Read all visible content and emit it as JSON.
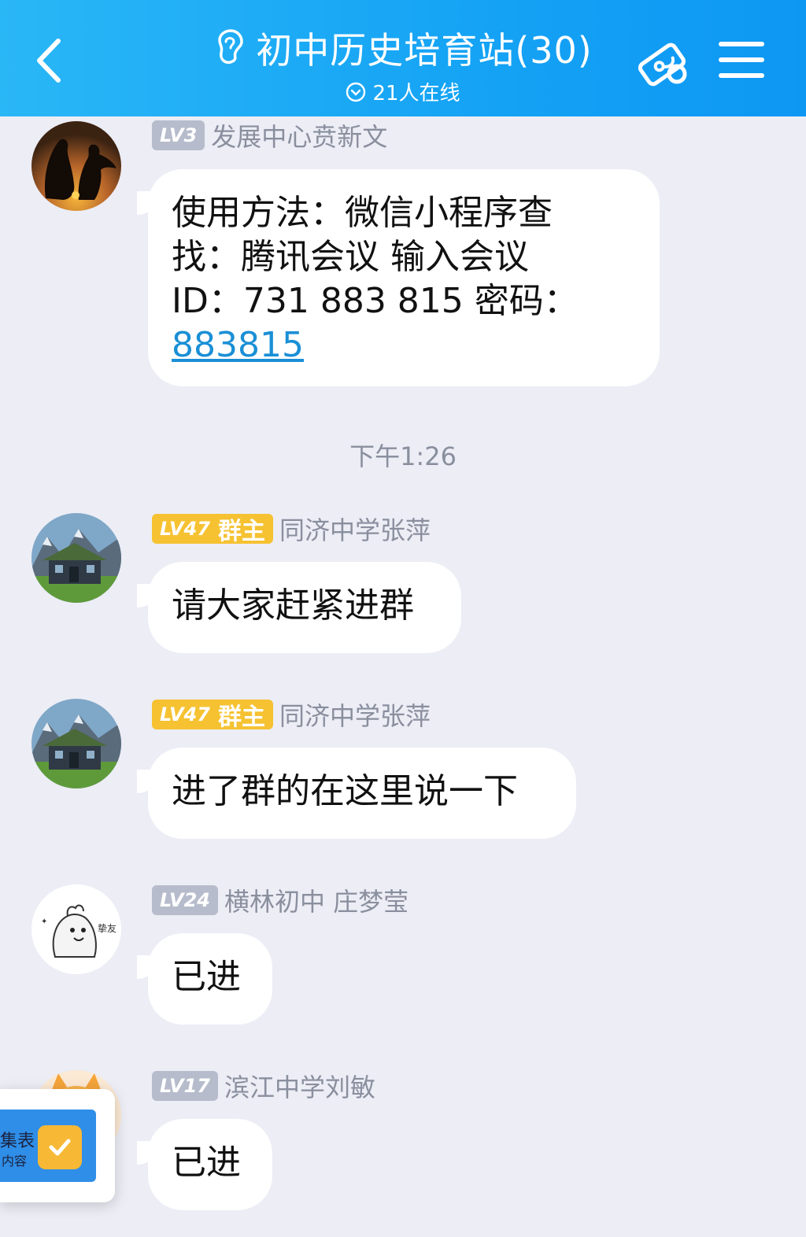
{
  "header": {
    "title": "初中历史培育站(30)",
    "online": "21人在线"
  },
  "messages": [
    {
      "level": "LV3",
      "sender": "发展中心贲新文",
      "lines": [
        "使用方法：微信小程序查",
        "找：腾讯会议  输入会议",
        "ID：731 883 815  密码："
      ],
      "link": "883815"
    },
    {
      "level": "LV47",
      "role": "群主",
      "sender": "同济中学张萍",
      "text": "请大家赶紧进群"
    },
    {
      "level": "LV47",
      "role": "群主",
      "sender": "同济中学张萍",
      "text": "进了群的在这里说一下"
    },
    {
      "level": "LV24",
      "sender": "横林初中 庄梦莹",
      "text": "已进"
    },
    {
      "level": "LV17",
      "sender": "滨江中学刘敏",
      "text": "已进"
    }
  ],
  "timestamp": "下午1:26",
  "floating_card": {
    "line1": "集表",
    "line2": "内容"
  },
  "avatar_watermark": "挚友",
  "colors": {
    "header_start": "#2ab7f6",
    "header_end": "#0d97f3",
    "background": "#ecedf5",
    "owner_badge": "#f6c232",
    "level_badge": "#b6bccb",
    "link": "#1a8fd6"
  }
}
